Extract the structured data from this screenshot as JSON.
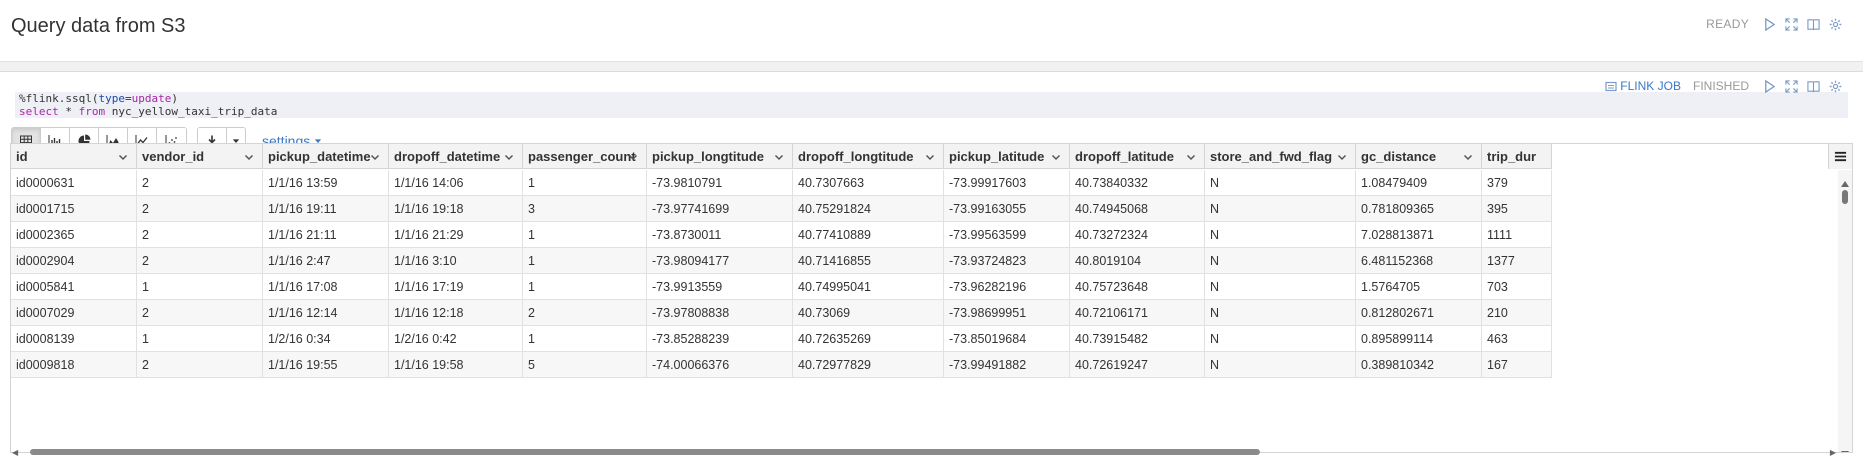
{
  "page": {
    "title": "Query data from S3",
    "status": "READY"
  },
  "paragraph": {
    "code": {
      "line1_prefix": "%flink.ssql(",
      "line1_param_key": "type",
      "line1_eq": "=",
      "line1_param_val": "update",
      "line1_suffix": ")",
      "line2_select": "select",
      "line2_mid": " * ",
      "line2_from": "from",
      "line2_table": " nyc_yellow_taxi_trip_data"
    },
    "job_link": "FLINK JOB",
    "status": "FINISHED",
    "settings_label": "settings"
  },
  "icons": {
    "run": "play-icon",
    "fullscreen": "expand-icon",
    "book": "book-icon",
    "settings": "gear-icon",
    "table": "table-icon",
    "bar": "bar-chart-icon",
    "pie": "pie-chart-icon",
    "area": "area-chart-icon",
    "line": "line-chart-icon",
    "scatter": "scatter-chart-icon",
    "download": "download-icon",
    "menu": "menu-icon"
  },
  "table": {
    "columns": [
      "id",
      "vendor_id",
      "pickup_datetime",
      "dropoff_datetime",
      "passenger_count",
      "pickup_longtitude",
      "dropoff_longtitude",
      "pickup_latitude",
      "dropoff_latitude",
      "store_and_fwd_flag",
      "gc_distance",
      "trip_dur"
    ],
    "rows": [
      [
        "id0000631",
        "2",
        "1/1/16 13:59",
        "1/1/16 14:06",
        "1",
        "-73.9810791",
        "40.7307663",
        "-73.99917603",
        "40.73840332",
        "N",
        "1.08479409",
        "379"
      ],
      [
        "id0001715",
        "2",
        "1/1/16 19:11",
        "1/1/16 19:18",
        "3",
        "-73.97741699",
        "40.75291824",
        "-73.99163055",
        "40.74945068",
        "N",
        "0.781809365",
        "395"
      ],
      [
        "id0002365",
        "2",
        "1/1/16 21:11",
        "1/1/16 21:29",
        "1",
        "-73.8730011",
        "40.77410889",
        "-73.99563599",
        "40.73272324",
        "N",
        "7.028813871",
        "1111"
      ],
      [
        "id0002904",
        "2",
        "1/1/16 2:47",
        "1/1/16 3:10",
        "1",
        "-73.98094177",
        "40.71416855",
        "-73.93724823",
        "40.8019104",
        "N",
        "6.481152368",
        "1377"
      ],
      [
        "id0005841",
        "1",
        "1/1/16 17:08",
        "1/1/16 17:19",
        "1",
        "-73.9913559",
        "40.74995041",
        "-73.96282196",
        "40.75723648",
        "N",
        "1.5764705",
        "703"
      ],
      [
        "id0007029",
        "2",
        "1/1/16 12:14",
        "1/1/16 12:18",
        "2",
        "-73.97808838",
        "40.73069",
        "-73.98699951",
        "40.72106171",
        "N",
        "0.812802671",
        "210"
      ],
      [
        "id0008139",
        "1",
        "1/2/16 0:34",
        "1/2/16 0:42",
        "1",
        "-73.85288239",
        "40.72635269",
        "-73.85019684",
        "40.73915482",
        "N",
        "0.895899114",
        "463"
      ],
      [
        "id0009818",
        "2",
        "1/1/16 19:55",
        "1/1/16 19:58",
        "5",
        "-74.00066376",
        "40.72977829",
        "-73.99491882",
        "40.72619247",
        "N",
        "0.389810342",
        "167"
      ]
    ]
  }
}
